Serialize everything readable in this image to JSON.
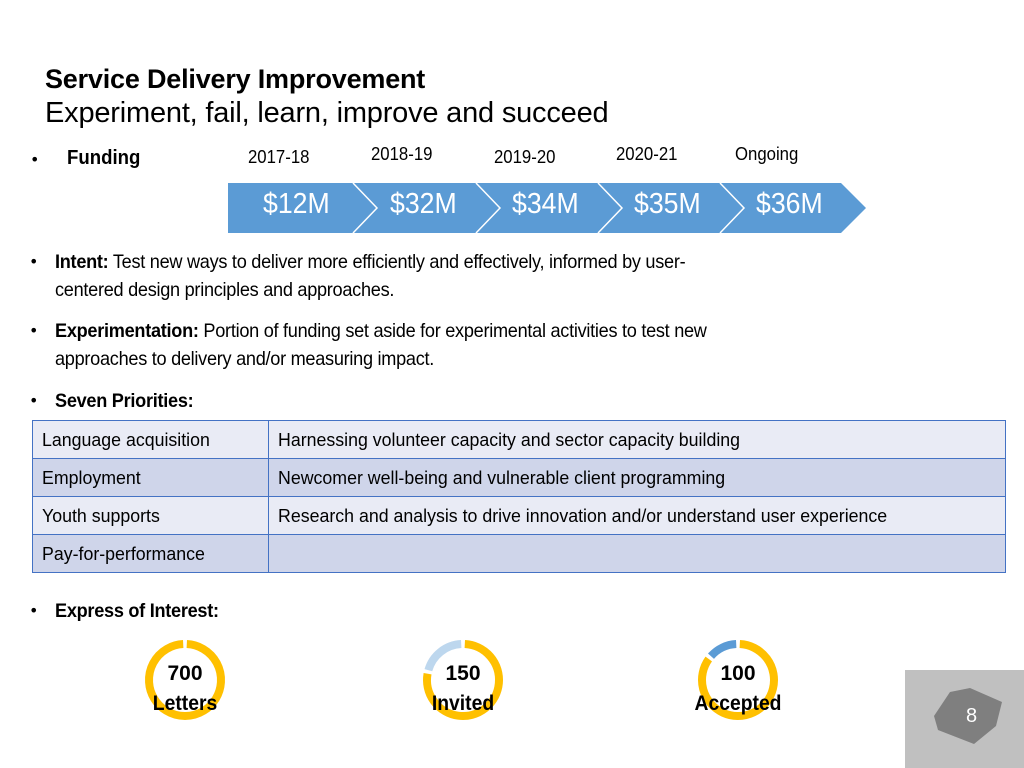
{
  "header": {
    "title": "Service Delivery Improvement",
    "subtitle": "Experiment, fail, learn, improve and succeed"
  },
  "funding": {
    "label": "Funding",
    "bullet": "•",
    "periods": [
      {
        "year": "2017-18",
        "amount": "$12M"
      },
      {
        "year": "2018-19",
        "amount": "$32M"
      },
      {
        "year": "2019-20",
        "amount": "$34M"
      },
      {
        "year": "2020-21",
        "amount": "$35M"
      },
      {
        "year": "Ongoing",
        "amount": "$36M"
      }
    ],
    "chevron_color": "#5B9BD5"
  },
  "bullets": {
    "intent": {
      "label": "Intent:",
      "line1": " Test new ways to deliver more efficiently and effectively, informed by user-",
      "line2": "centered design principles and approaches."
    },
    "experimentation": {
      "label": "Experimentation:",
      "line1": " Portion of funding set aside for experimental activities to test new",
      "line2": "approaches to delivery and/or measuring impact."
    },
    "priorities": {
      "label": "Seven Priorities:"
    },
    "interest": {
      "label": "Express of Interest:"
    }
  },
  "priorities_table": {
    "rows": [
      [
        "Language acquisition",
        "Harnessing volunteer capacity and sector capacity building"
      ],
      [
        "Employment",
        "Newcomer well-being and vulnerable client programming"
      ],
      [
        "Youth supports",
        "Research and analysis to drive innovation and/or understand user experience"
      ],
      [
        "Pay-for-performance",
        ""
      ]
    ],
    "border_color": "#4472C4",
    "light_row_color": "#E9EBF5",
    "dark_row_color": "#CFD5EA"
  },
  "expression_of_interest": [
    {
      "value": "700",
      "label": "Letters",
      "highlight_fraction": 0,
      "highlight_color": "#5B9BD5"
    },
    {
      "value": "150",
      "label": "Invited",
      "highlight_fraction": 0.214,
      "highlight_color": "#BDD7EE"
    },
    {
      "value": "100",
      "label": "Accepted",
      "highlight_fraction": 0.143,
      "highlight_color": "#5B9BD5"
    }
  ],
  "donut_base_color": "#FFC000",
  "page": {
    "number": "8"
  }
}
